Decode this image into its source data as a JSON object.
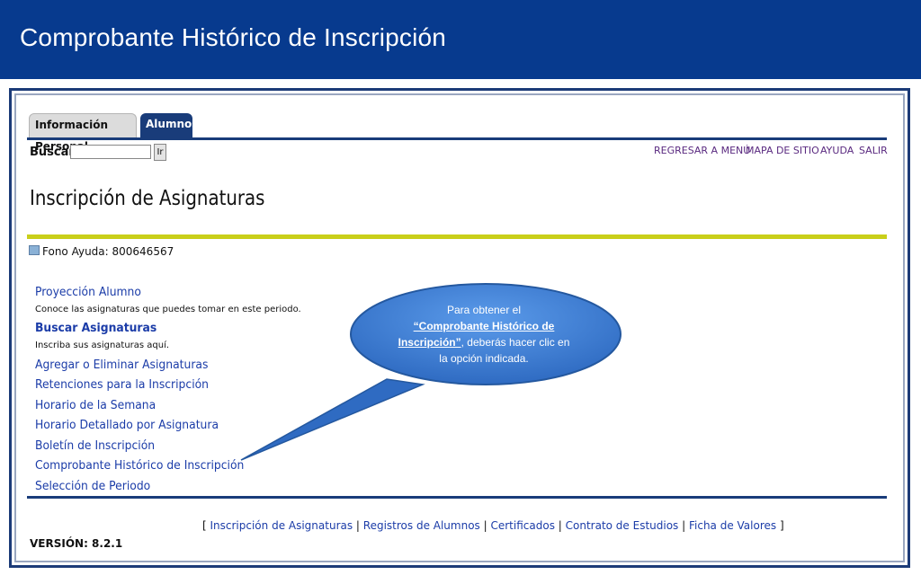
{
  "banner": {
    "title": "Comprobante Histórico de Inscripción"
  },
  "tabs": [
    {
      "label": "Información Personal"
    },
    {
      "label": "Alumnos"
    }
  ],
  "search": {
    "label": "Buscar",
    "value": "",
    "button": "Ir"
  },
  "top_links": [
    "REGRESAR A MENÚ",
    "MAPA DE SITIO",
    "AYUDA",
    "SALIR"
  ],
  "page": {
    "heading": "Inscripción de Asignaturas",
    "help": "Fono Ayuda: 800646567"
  },
  "menu": {
    "proyeccion": "Proyección Alumno",
    "proyeccion_desc": "Conoce las asignaturas que puedes tomar en este periodo.",
    "buscar": "Buscar Asignaturas",
    "buscar_desc": "Inscriba sus asignaturas aquí.",
    "items": [
      "Agregar o Eliminar Asignaturas",
      "Retenciones para la Inscripción",
      "Horario de la Semana",
      "Horario Detallado por Asignatura",
      "Boletín de Inscripción",
      "Comprobante Histórico de Inscripción",
      "Selección de Periodo"
    ]
  },
  "footer": {
    "links": [
      "Inscripción de Asignaturas",
      "Registros de Alumnos",
      "Certificados",
      "Contrato de Estudios",
      "Ficha de Valores"
    ],
    "version": "VERSIÓN: 8.2.1"
  },
  "callout": {
    "line1": "Para obtener el",
    "emphasis": "“Comprobante Histórico de Inscripción”",
    "line2": ", deberás hacer clic en la opción indicada."
  },
  "colors": {
    "banner": "#073a8e",
    "nav": "#193c7a",
    "accent_bar": "#c9cf1a",
    "link": "#1b3ca8",
    "callout": "#3a7bd5"
  }
}
